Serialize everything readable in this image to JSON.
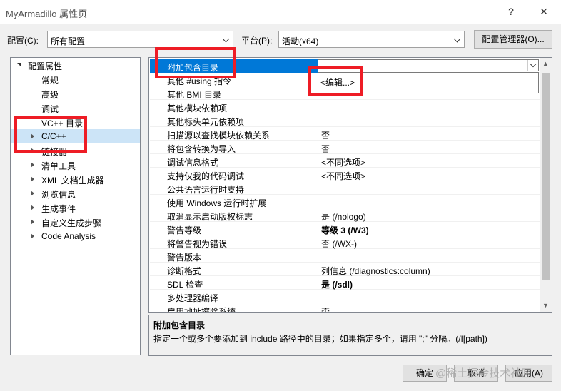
{
  "window": {
    "title": "MyArmadillo 属性页",
    "help_label": "?",
    "close_label": "✕"
  },
  "toolbar": {
    "config_label": "配置(C):",
    "config_value": "所有配置",
    "platform_label": "平台(P):",
    "platform_value": "活动(x64)",
    "config_manager_label": "配置管理器(O)..."
  },
  "tree": {
    "items": [
      {
        "label": "配置属性",
        "expander": "down",
        "level": 0
      },
      {
        "label": "常规",
        "expander": "",
        "level": 1
      },
      {
        "label": "高级",
        "expander": "",
        "level": 1
      },
      {
        "label": "调试",
        "expander": "",
        "level": 1
      },
      {
        "label": "VC++ 目录",
        "expander": "",
        "level": 1
      },
      {
        "label": "C/C++",
        "expander": "right",
        "level": 1,
        "selected": true
      },
      {
        "label": "链接器",
        "expander": "right",
        "level": 1
      },
      {
        "label": "清单工具",
        "expander": "right",
        "level": 1
      },
      {
        "label": "XML 文档生成器",
        "expander": "right",
        "level": 1
      },
      {
        "label": "浏览信息",
        "expander": "right",
        "level": 1
      },
      {
        "label": "生成事件",
        "expander": "right",
        "level": 1
      },
      {
        "label": "自定义生成步骤",
        "expander": "right",
        "level": 1
      },
      {
        "label": "Code Analysis",
        "expander": "right",
        "level": 1
      }
    ]
  },
  "grid": {
    "rows": [
      {
        "name": "附加包含目录",
        "value": "",
        "selected": true
      },
      {
        "name": "其他 #using 指令",
        "value": ""
      },
      {
        "name": "其他 BMI 目录",
        "value": ""
      },
      {
        "name": "其他模块依赖项",
        "value": ""
      },
      {
        "name": "其他标头单元依赖项",
        "value": ""
      },
      {
        "name": "扫描源以查找模块依赖关系",
        "value": "否"
      },
      {
        "name": "将包含转换为导入",
        "value": "否"
      },
      {
        "name": "调试信息格式",
        "value": "<不同选项>"
      },
      {
        "name": "支持仅我的代码调试",
        "value": "<不同选项>"
      },
      {
        "name": "公共语言运行时支持",
        "value": ""
      },
      {
        "name": "使用 Windows 运行时扩展",
        "value": ""
      },
      {
        "name": "取消显示启动版权标志",
        "value": "是 (/nologo)"
      },
      {
        "name": "警告等级",
        "value": "等级 3 (/W3)",
        "bold": true
      },
      {
        "name": "将警告视为错误",
        "value": "否 (/WX-)"
      },
      {
        "name": "警告版本",
        "value": ""
      },
      {
        "name": "诊断格式",
        "value": "列信息 (/diagnostics:column)"
      },
      {
        "name": "SDL 检查",
        "value": "是 (/sdl)",
        "bold": true
      },
      {
        "name": "多处理器编译",
        "value": ""
      },
      {
        "name": "启用地址擦除系统",
        "value": "否"
      }
    ],
    "dropdown_option": "<编辑...>"
  },
  "description": {
    "title": "附加包含目录",
    "text": "指定一个或多个要添加到 include 路径中的目录；如果指定多个，请用 \";\" 分隔。(/I[path])"
  },
  "footer": {
    "ok_label": "确定",
    "cancel_label": "取消",
    "apply_label": "应用(A)"
  },
  "watermark": "@稀土掘金技术社区",
  "colors": {
    "selection": "#0078d7",
    "tree_selection": "#cce4f7",
    "annotation": "#ee1c25"
  }
}
